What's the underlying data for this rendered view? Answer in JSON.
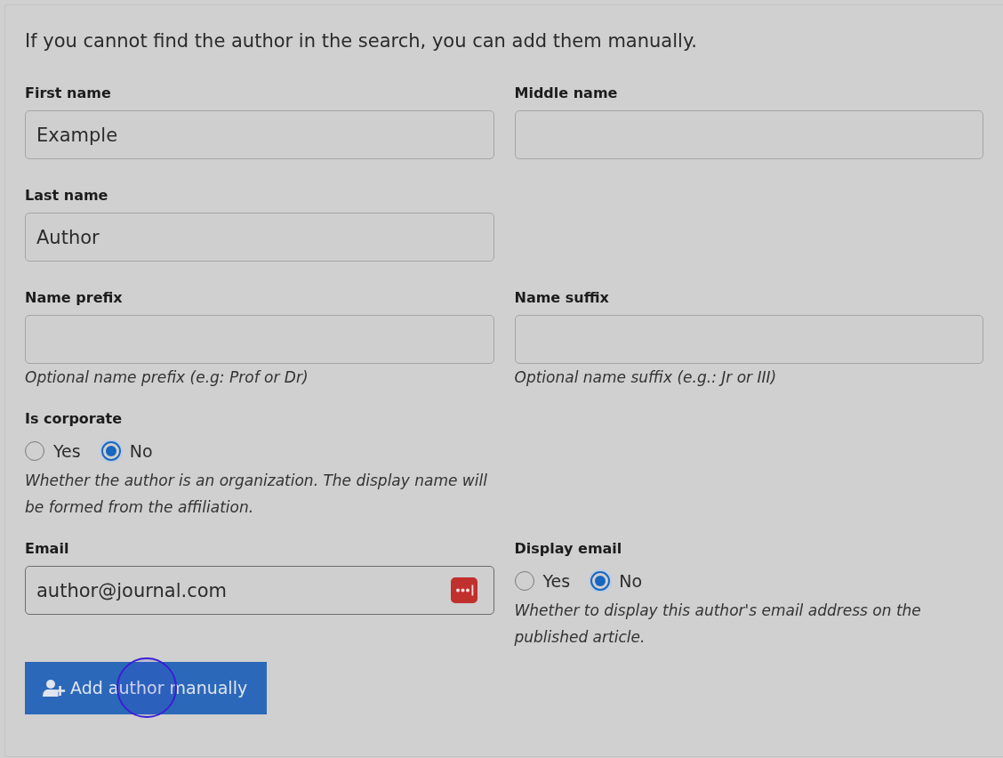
{
  "intro": "If you cannot find the author in the search, you can add them manually.",
  "rows": [
    {
      "fields": [
        {
          "kind": "text",
          "label": "First name",
          "value": "Example",
          "focused": false
        },
        {
          "kind": "text",
          "label": "Middle name",
          "focused": false
        }
      ]
    },
    {
      "fields": [
        {
          "kind": "text",
          "label": "Last name",
          "value": "Author",
          "focused": false
        }
      ]
    },
    {
      "fields": [
        {
          "kind": "text",
          "label": "Name prefix",
          "focused": false,
          "hint": "Optional name prefix (e.g: Prof or Dr)"
        },
        {
          "kind": "text",
          "label": "Name suffix",
          "focused": false,
          "hint": "Optional name suffix (e.g.: Jr or III)"
        }
      ]
    },
    {
      "fields": [
        {
          "kind": "radio",
          "label": "Is corporate",
          "options": [
            {
              "label": "Yes",
              "selected": false
            },
            {
              "label": "No",
              "selected": true
            }
          ],
          "hint": "Whether the author is an organization. The display name will be formed from the affiliation."
        }
      ]
    },
    {
      "fields": [
        {
          "kind": "text",
          "label": "Email",
          "value": "author@journal.com",
          "focused": true,
          "password_manager": true
        },
        {
          "kind": "radio",
          "label": "Display email",
          "options": [
            {
              "label": "Yes",
              "selected": false
            },
            {
              "label": "No",
              "selected": true
            }
          ],
          "hint": "Whether to display this author's email address on the published article."
        }
      ]
    }
  ],
  "button": {
    "label": "Add author manually",
    "click_marker": true
  }
}
